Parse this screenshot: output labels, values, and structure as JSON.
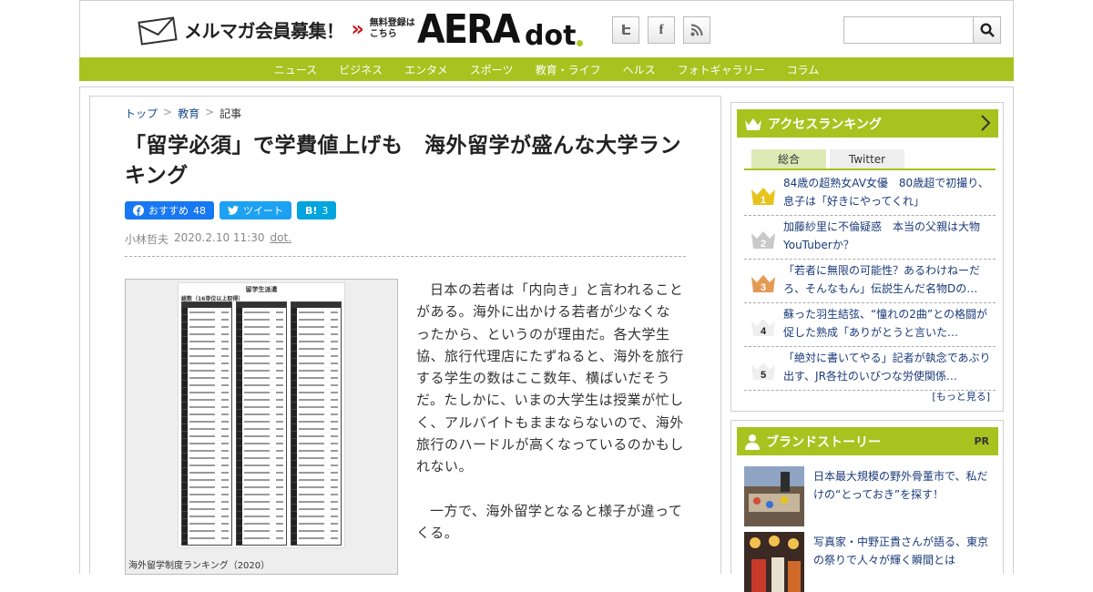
{
  "header": {
    "mailmag_label": "メルマガ会員募集！",
    "mailmag_free_line1": "無料登録は",
    "mailmag_free_line2": "こちら",
    "logo_main": "AERA",
    "logo_sub": "dot",
    "social_icons": [
      "twitter-icon",
      "facebook-icon",
      "rss-icon"
    ],
    "search_placeholder": ""
  },
  "nav": {
    "items": [
      "ニュース",
      "ビジネス",
      "エンタメ",
      "スポーツ",
      "教育・ライフ",
      "ヘルス",
      "フォトギャラリー",
      "コラム"
    ]
  },
  "colors": {
    "accent": "#a8c21f",
    "link": "#1a3a7a",
    "facebook": "#1877f2",
    "twitter": "#1da1f2",
    "hatena": "#00a4de"
  },
  "article": {
    "breadcrumb": {
      "top": "トップ",
      "section": "教育",
      "current": "記事"
    },
    "title": "「留学必須」で学費値上げも　海外留学が盛んな大学ランキング",
    "share": {
      "facebook_label": "おすすめ",
      "facebook_count": "48",
      "twitter_label": "ツイート",
      "hatena_label": "B!",
      "hatena_count": "3"
    },
    "author": "小林哲夫",
    "date": "2020.2.10 11:30",
    "source": "dot.",
    "figure": {
      "image_title": "留学生派遣",
      "image_subtitle": "総数（16単位以上取得）",
      "caption": "海外留学制度ランキング（2020）"
    },
    "paragraphs": [
      "日本の若者は「内向き」と言われることがある。海外に出かける若者が少なくなったから、というのが理由だ。各大学生協、旅行代理店にたずねると、海外を旅行する学生の数はここ数年、横ばいだそうだ。たしかに、いまの大学生は授業が忙しく、アルバイトもままならないので、海外旅行のハードルが高くなっているのかもしれない。",
      "一方で、海外留学となると様子が違ってくる。"
    ]
  },
  "sidebar": {
    "ranking": {
      "heading": "アクセスランキング",
      "tabs": [
        "総合",
        "Twitter"
      ],
      "items": [
        {
          "rank": "1",
          "text": "84歳の超熟女AV女優　80歳超で初撮り、息子は「好きにやってくれ」",
          "crown_color": "#e8c31c"
        },
        {
          "rank": "2",
          "text": "加藤紗里に不倫疑惑　本当の父親は大物YouTuberか？",
          "crown_color": "#c9c9c9"
        },
        {
          "rank": "3",
          "text": "「若者に無限の可能性？あるわけねーだろ、そんなもん」伝説生んだ名物Dの…",
          "crown_color": "#e49a55"
        },
        {
          "rank": "4",
          "text": "蘇った羽生結弦、“憧れの2曲”との格闘が促した熟成「ありがとうと言いた…",
          "crown_color": "#eeeeee"
        },
        {
          "rank": "5",
          "text": "「絶対に書いてやる」記者が執念であぶり出す、JR各社のいびつな労使関係…",
          "crown_color": "#eeeeee"
        }
      ],
      "more": "[もっと見る]"
    },
    "brand": {
      "heading": "ブランドストーリー",
      "pr": "PR",
      "items": [
        {
          "line1": "日本最大規模の野外骨董市で、私だ",
          "line2": "けの“とっておき”を探す！"
        },
        {
          "line1": "写真家・中野正貴さんが語る、東京",
          "line2": "の祭りで人々が輝く瞬間とは"
        }
      ]
    }
  }
}
